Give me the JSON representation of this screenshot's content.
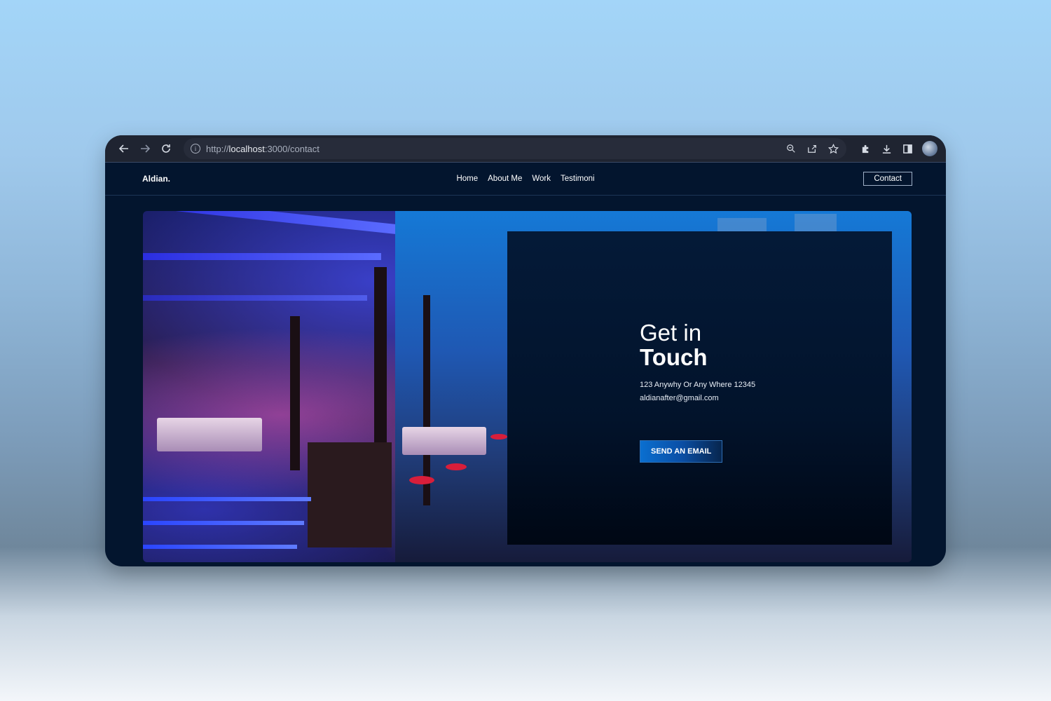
{
  "browser": {
    "url_scheme": "http://",
    "url_host": "localhost",
    "url_rest": ":3000/contact"
  },
  "site": {
    "brand": "Aldian.",
    "menu": [
      "Home",
      "About Me",
      "Work",
      "Testimoni"
    ],
    "contact_button": "Contact"
  },
  "contact": {
    "title_line1": "Get in",
    "title_line2": "Touch",
    "address": "123 Anywhy Or Any Where 12345",
    "email": "aldianafter@gmail.com",
    "cta": "SEND AN EMAIL"
  }
}
